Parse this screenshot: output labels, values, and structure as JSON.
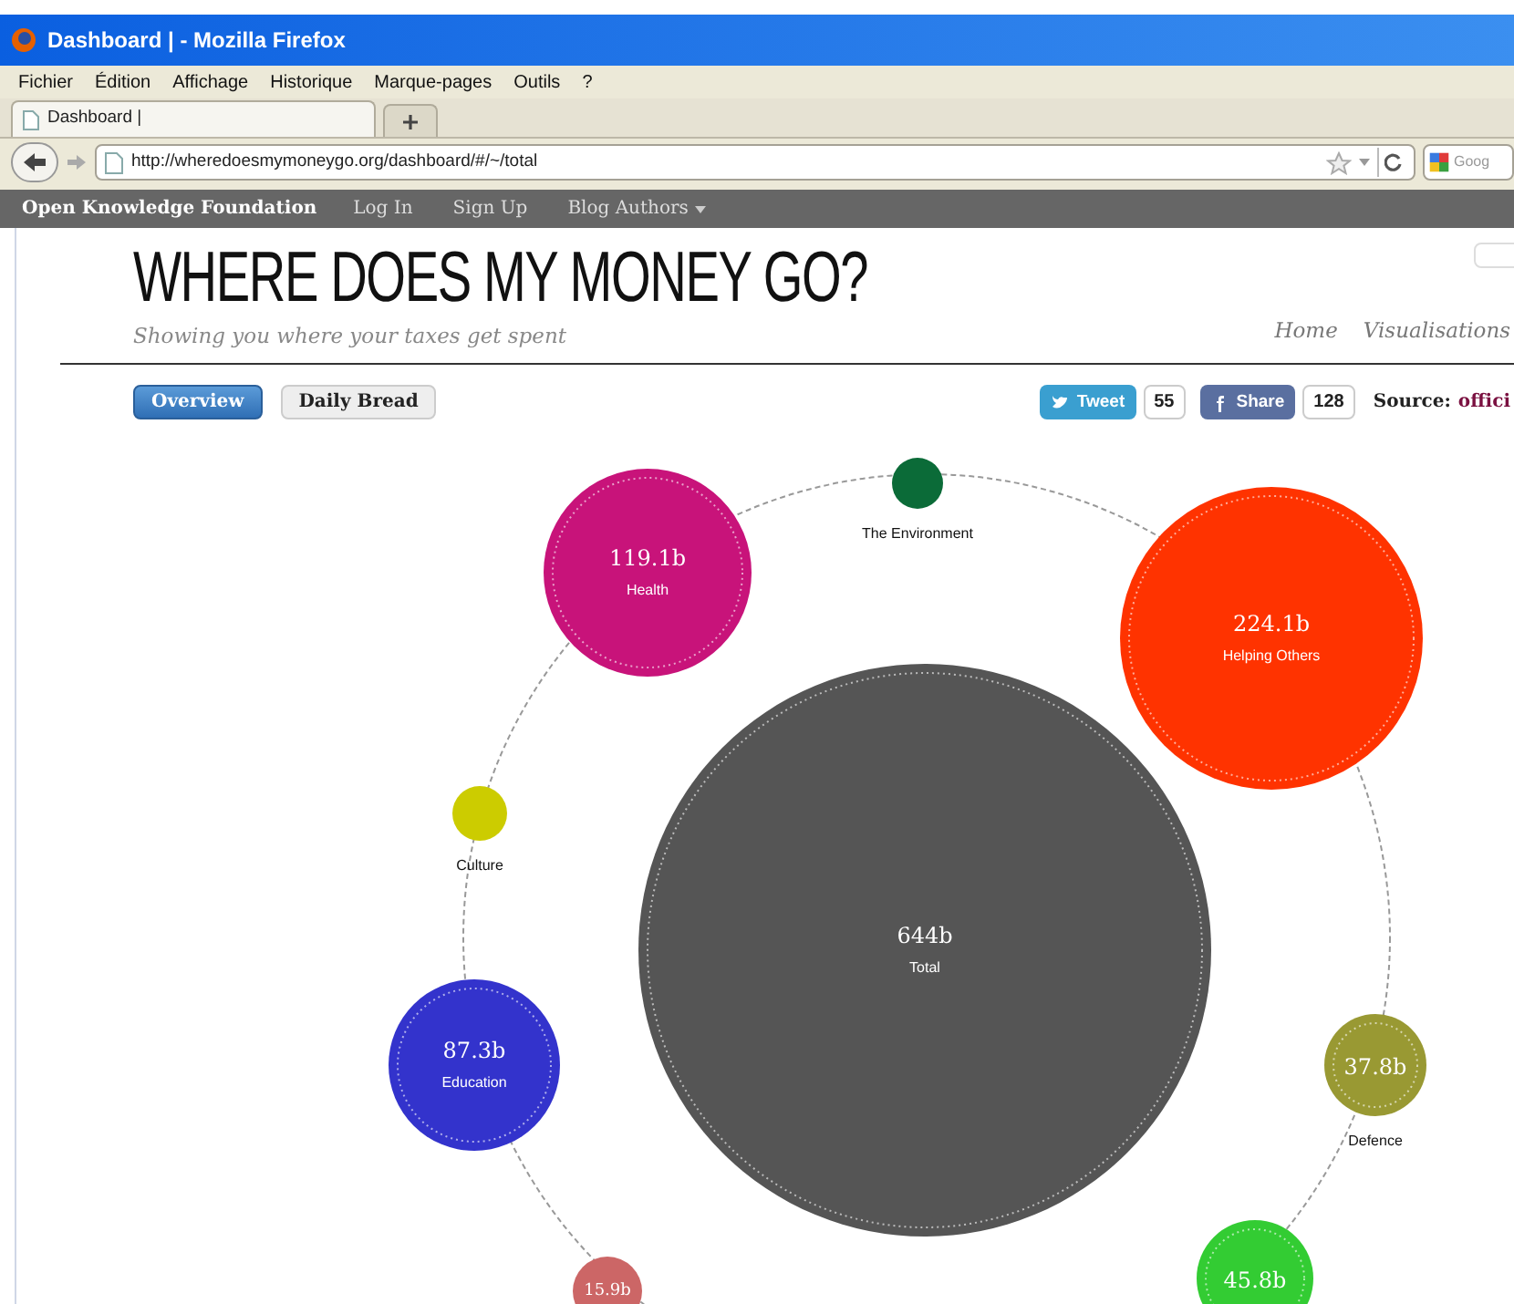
{
  "window": {
    "title": "Dashboard | - Mozilla Firefox"
  },
  "menu": [
    "Fichier",
    "Édition",
    "Affichage",
    "Historique",
    "Marque-pages",
    "Outils",
    "?"
  ],
  "tabs": [
    {
      "label": "Dashboard |",
      "selected": true
    }
  ],
  "address_bar": {
    "url": "http://wheredoesmymoneygo.org/dashboard/#/~/total"
  },
  "search": {
    "placeholder": "Goog"
  },
  "site_bar": {
    "brand": "Open Knowledge Foundation",
    "links": [
      "Log In",
      "Sign Up",
      "Blog Authors"
    ]
  },
  "header": {
    "title": "WHERE DOES MY MONEY GO?",
    "subtitle": "Showing you where your taxes get spent",
    "nav": [
      "Home",
      "Visualisations"
    ]
  },
  "view_tabs": [
    {
      "label": "Overview",
      "selected": true
    },
    {
      "label": "Daily Bread",
      "selected": false
    }
  ],
  "social": [
    {
      "kind": "twitter",
      "label": "Tweet",
      "count": "55"
    },
    {
      "kind": "facebook",
      "label": "Share",
      "count": "128"
    }
  ],
  "source": {
    "label": "Source:",
    "value": "offici"
  },
  "bubbles": [
    {
      "label": "Health",
      "value": "119.1b",
      "color": "#c8137a"
    },
    {
      "label": "The Environment",
      "color": "#0b6b38"
    },
    {
      "label": "Helping Others",
      "value": "224.1b",
      "color": "#ff3300"
    },
    {
      "label": "Culture",
      "color": "#cccc00"
    },
    {
      "label": "Total",
      "value": "644b",
      "color": "#555555"
    },
    {
      "label": "Education",
      "value": "87.3b",
      "color": "#3333cc"
    },
    {
      "label": "Defence",
      "value": "37.8b",
      "color": "#999933"
    },
    {
      "value": "45.8b",
      "color": "#33cc33"
    },
    {
      "value": "15.9b",
      "color": "#cc6666"
    }
  ]
}
